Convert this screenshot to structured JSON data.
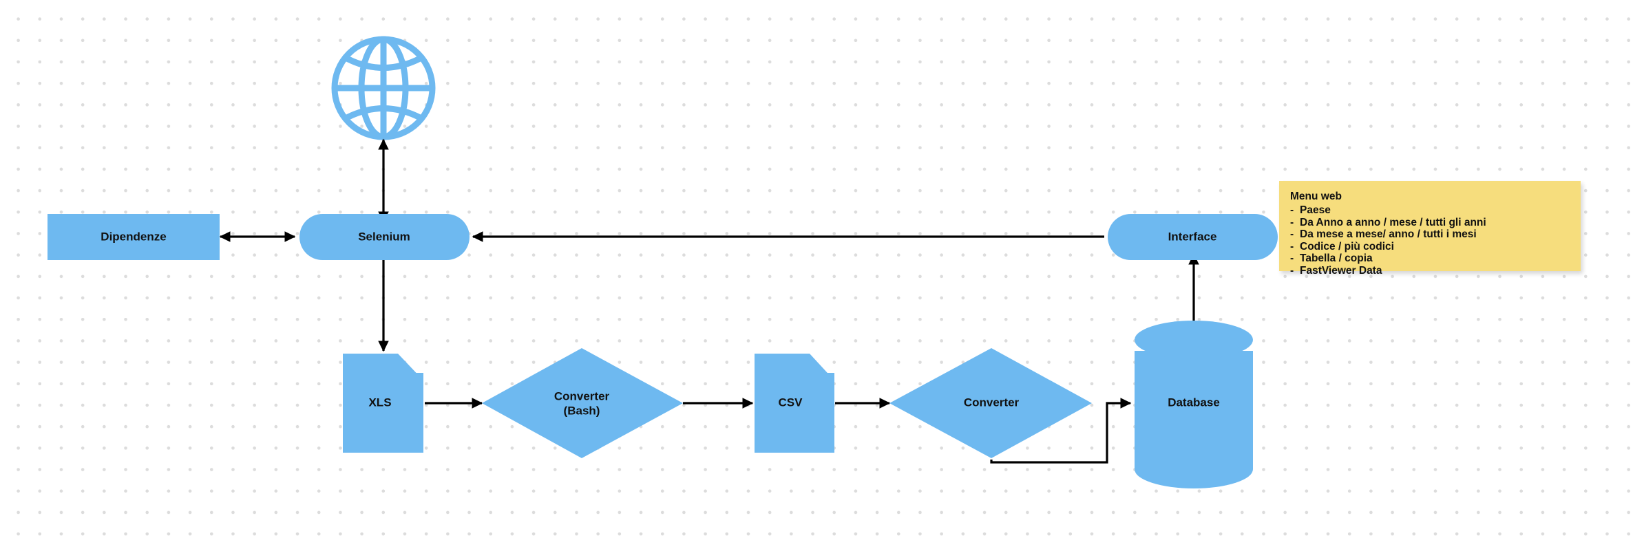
{
  "canvas": {
    "background_color": "#ffffff",
    "dot_grid_color": "#dcdcdc",
    "shape_fill": "#6EB9F0",
    "connector_color": "#000000",
    "note_color": "#F6DD7D"
  },
  "nodes": {
    "globe": {
      "label": "",
      "icon": "globe-icon",
      "shape": "globe"
    },
    "dipendenze": {
      "label": "Dipendenze",
      "shape": "rectangle"
    },
    "selenium": {
      "label": "Selenium",
      "shape": "rounded-rectangle"
    },
    "interface": {
      "label": "Interface",
      "shape": "rounded-rectangle"
    },
    "xls": {
      "label": "XLS",
      "shape": "document"
    },
    "converter_bash_line1": {
      "label": "Converter",
      "shape": "diamond"
    },
    "converter_bash_line2": {
      "label": "(Bash)"
    },
    "csv": {
      "label": "CSV",
      "shape": "document"
    },
    "converter": {
      "label": "Converter",
      "shape": "diamond"
    },
    "database": {
      "label": "Database",
      "shape": "cylinder"
    }
  },
  "connectors": [
    {
      "name": "globe-selenium",
      "from": "globe",
      "to": "selenium",
      "arrows": "both"
    },
    {
      "name": "dipendenze-selenium",
      "from": "dipendenze",
      "to": "selenium",
      "arrows": "both"
    },
    {
      "name": "interface-selenium",
      "from": "interface",
      "to": "selenium",
      "arrows": "end"
    },
    {
      "name": "selenium-xls",
      "from": "selenium",
      "to": "xls",
      "arrows": "end"
    },
    {
      "name": "xls-converter-bash",
      "from": "xls",
      "to": "converter_bash",
      "arrows": "end"
    },
    {
      "name": "converter-bash-csv",
      "from": "converter_bash",
      "to": "csv",
      "arrows": "end"
    },
    {
      "name": "csv-converter",
      "from": "csv",
      "to": "converter",
      "arrows": "end"
    },
    {
      "name": "converter-database",
      "from": "converter",
      "to": "database",
      "arrows": "end"
    },
    {
      "name": "database-interface",
      "from": "database",
      "to": "interface",
      "arrows": "end"
    }
  ],
  "note": {
    "title": "Menu web",
    "items": [
      "Paese",
      "Da Anno a anno / mese / tutti gli anni",
      "Da mese a mese/ anno / tutti i mesi",
      "Codice / più codici",
      "Tabella / copia",
      "FastViewer Data"
    ]
  }
}
